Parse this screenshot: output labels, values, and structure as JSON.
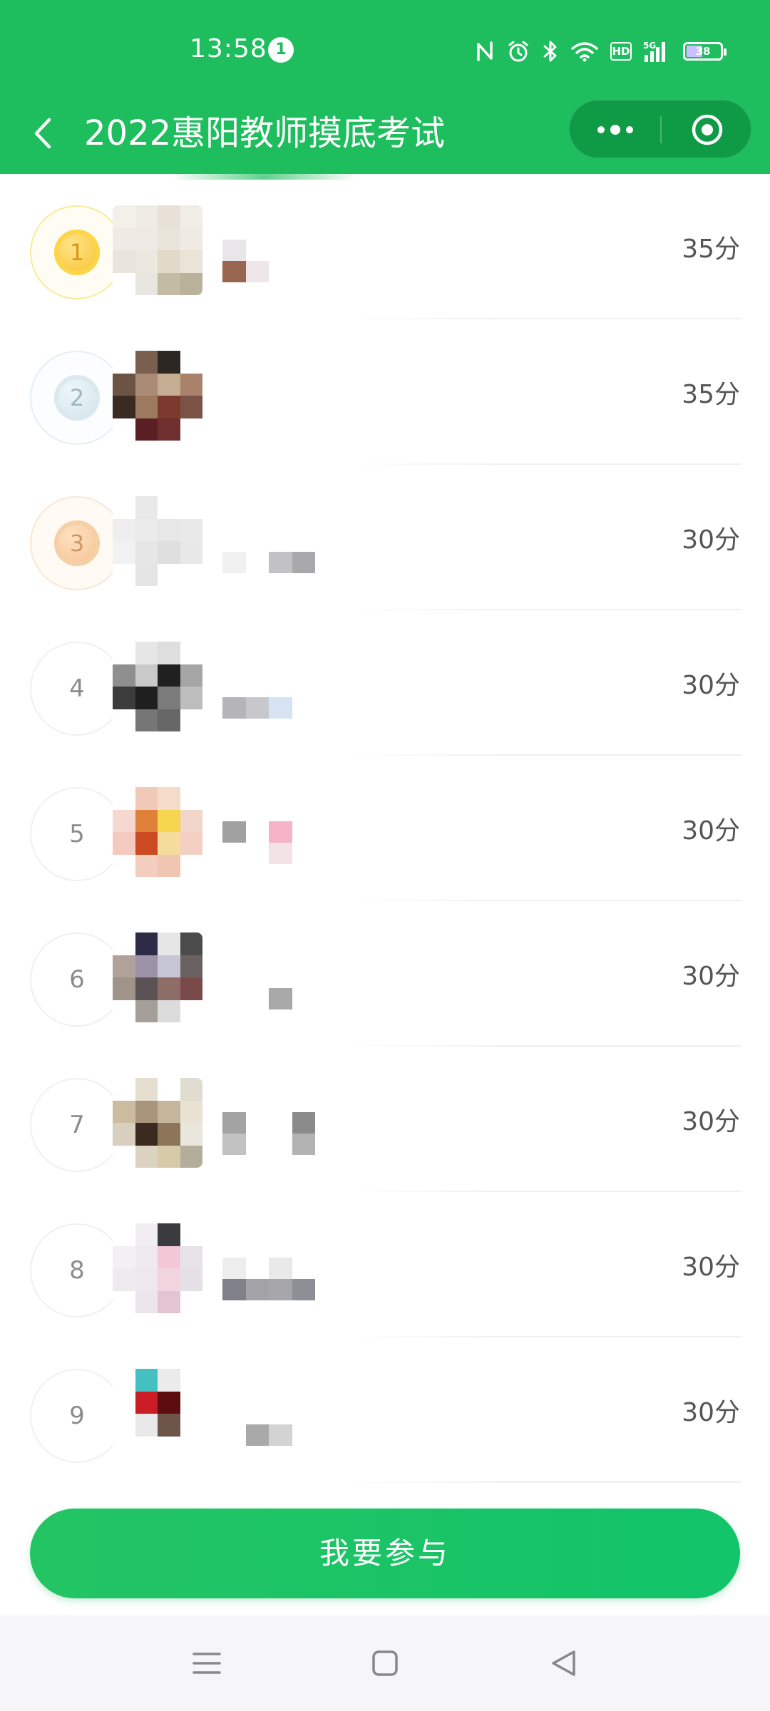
{
  "status_bar": {
    "time": "13:58",
    "notification_count": "1",
    "network": "5G",
    "hd": "HD",
    "battery": "38"
  },
  "nav": {
    "title": "2022惠阳教师摸底考试"
  },
  "leaderboard": {
    "rows": [
      {
        "rank": "1",
        "score": "35分",
        "medal": "gold",
        "avatar_colors": [
          "#f3efe9",
          "#efebe5",
          "#e7e1d7",
          "#f0ece6",
          "#efebe4",
          "#eeeae3",
          "#e9e4da",
          "#efeae3",
          "#eae5dc",
          "#ece7df",
          "#e2d9c9",
          "#e9e3d8",
          "#ffffff",
          "#e8e6e1",
          "#c3bba4",
          "#b9b19a"
        ],
        "name_colors": [
          "#e9e6ea",
          "#ffffff",
          "#ffffff",
          "#ffffff",
          "#98654f",
          "#efe6e9",
          "#ffffff",
          "#ffffff"
        ],
        "progress_hint": 1
      },
      {
        "rank": "2",
        "score": "35分",
        "medal": "silver",
        "avatar_colors": [
          "#ffffff",
          "#7a5f4e",
          "#2d2724",
          "#ffffff",
          "#6b5443",
          "#a98b76",
          "#c4ad91",
          "#a9826c",
          "#3a2a22",
          "#9c7a60",
          "#7c3a2f",
          "#7b5346",
          "#ffffff",
          "#5a1f22",
          "#6e2f2e",
          "#ffffff"
        ],
        "name_colors": [
          "#ffffff",
          "#ffffff",
          "#ffffff",
          "#ffffff",
          "#ffffff",
          "#ffffff",
          "#ffffff",
          "#ffffff"
        ]
      },
      {
        "rank": "3",
        "score": "30分",
        "medal": "bronze",
        "avatar_colors": [
          "#ffffff",
          "#e9e9e9",
          "#ffffff",
          "#ffffff",
          "#eeeeee",
          "#ebebeb",
          "#e7e7e7",
          "#e9e9e9",
          "#f2f2f2",
          "#e6e6e6",
          "#dfdfdf",
          "#e8e8e8",
          "#ffffff",
          "#e5e5e5",
          "#ffffff",
          "#ffffff"
        ],
        "name_colors": [
          "#ffffff",
          "#ffffff",
          "#ffffff",
          "#ffffff",
          "#f1f1f1",
          "#ffffff",
          "#c2c2c4",
          "#a9a9ad"
        ]
      },
      {
        "rank": "4",
        "score": "30分",
        "medal": "",
        "avatar_colors": [
          "#ffffff",
          "#e6e6e6",
          "#dedede",
          "#ffffff",
          "#8f8f8f",
          "#c9c9c9",
          "#202020",
          "#a6a6a6",
          "#3c3c3c",
          "#1f1f1f",
          "#7b7b7b",
          "#bdbdbd",
          "#ffffff",
          "#767676",
          "#676767",
          "#ffffff"
        ],
        "name_colors": [
          "#ffffff",
          "#ffffff",
          "#ffffff",
          "#ffffff",
          "#b5b5b9",
          "#c8c8cc",
          "#d5e3f3",
          "#ffffff"
        ]
      },
      {
        "rank": "5",
        "score": "30分",
        "medal": "",
        "avatar_colors": [
          "#ffffff",
          "#f0c9b9",
          "#f3dcca",
          "#ffffff",
          "#f6d8d0",
          "#e0813a",
          "#f5d64e",
          "#f2d6cc",
          "#f4c9c0",
          "#cb4a22",
          "#f5dc9c",
          "#f4cfc4",
          "#ffffff",
          "#f3cdbd",
          "#f0c6b2",
          "#ffffff"
        ],
        "name_colors": [
          "#a1a1a1",
          "#ffffff",
          "#f4b3c6",
          "#ffffff",
          "#ffffff",
          "#ffffff",
          "#f3e2e6",
          "#ffffff"
        ]
      },
      {
        "rank": "6",
        "score": "30分",
        "medal": "",
        "avatar_colors": [
          "#ffffff",
          "#2e2b48",
          "#e6e6e6",
          "#4b4b4b",
          "#b1a19b",
          "#9d92a8",
          "#c6c6d4",
          "#6b6160",
          "#a09387",
          "#5a5254",
          "#8d6d66",
          "#7a4a4a",
          "#ffffff",
          "#a59f9a",
          "#dcdcdc",
          "#ffffff"
        ],
        "name_colors": [
          "#ffffff",
          "#ffffff",
          "#ffffff",
          "#ffffff",
          "#ffffff",
          "#ffffff",
          "#a8a8a8",
          "#ffffff"
        ]
      },
      {
        "rank": "7",
        "score": "30分",
        "medal": "",
        "avatar_colors": [
          "#ffffff",
          "#e6dfcf",
          "#ffffff",
          "#e0dccf",
          "#cbbca0",
          "#a9947c",
          "#c4b59b",
          "#e9e2d2",
          "#d8cfbe",
          "#3b2a20",
          "#8c7558",
          "#e9e6dc",
          "#ffffff",
          "#dcd2c0",
          "#d6caa9",
          "#b2ae9b"
        ],
        "name_colors": [
          "#a3a3a3",
          "#ffffff",
          "#ffffff",
          "#8b8b8b",
          "#c2c2c2",
          "#ffffff",
          "#ffffff",
          "#b3b3b3"
        ]
      },
      {
        "rank": "8",
        "score": "30分",
        "medal": "",
        "avatar_colors": [
          "#ffffff",
          "#f0eef1",
          "#3b3b3d",
          "#ffffff",
          "#f2f0f2",
          "#eeeaf0",
          "#f3c7d6",
          "#e6e3e8",
          "#eeeaef",
          "#ede8ec",
          "#f2d4df",
          "#e5e0e6",
          "#ffffff",
          "#ebe6ec",
          "#e4c3d3",
          "#ffffff"
        ],
        "name_colors": [
          "#ededed",
          "#ffffff",
          "#e9e9e9",
          "#ffffff",
          "#7f8088",
          "#a4a4a8",
          "#a7a7ab",
          "#8d8f96"
        ]
      },
      {
        "rank": "9",
        "score": "30分",
        "medal": "",
        "avatar_colors": [
          "#ffffff",
          "#45c0c0",
          "#ebebeb",
          "#ffffff",
          "#ffffff",
          "#c91c24",
          "#5d0c10",
          "#ffffff",
          "#ffffff",
          "#e9e9e9",
          "#6d5547",
          "#ffffff",
          "#ffffff",
          "#ffffff",
          "#ffffff",
          "#ffffff"
        ],
        "name_colors": [
          "#ffffff",
          "#ffffff",
          "#ffffff",
          "#ffffff",
          "#ffffff",
          "#a9a9a9",
          "#d3d3d3",
          "#ffffff"
        ]
      }
    ]
  },
  "join_button": {
    "label": "我要参与"
  },
  "colors": {
    "brand_green": "#1ebd5e",
    "capsule_bg": "#0f9b46",
    "score_text": "#555555",
    "rank_text": "#8c8c8c"
  },
  "icons": {
    "back": "chevron-left-icon",
    "more": "more-dots-icon",
    "close": "target-close-icon",
    "nav_menu": "menu-icon",
    "nav_home": "home-square-icon",
    "nav_back": "triangle-back-icon"
  }
}
